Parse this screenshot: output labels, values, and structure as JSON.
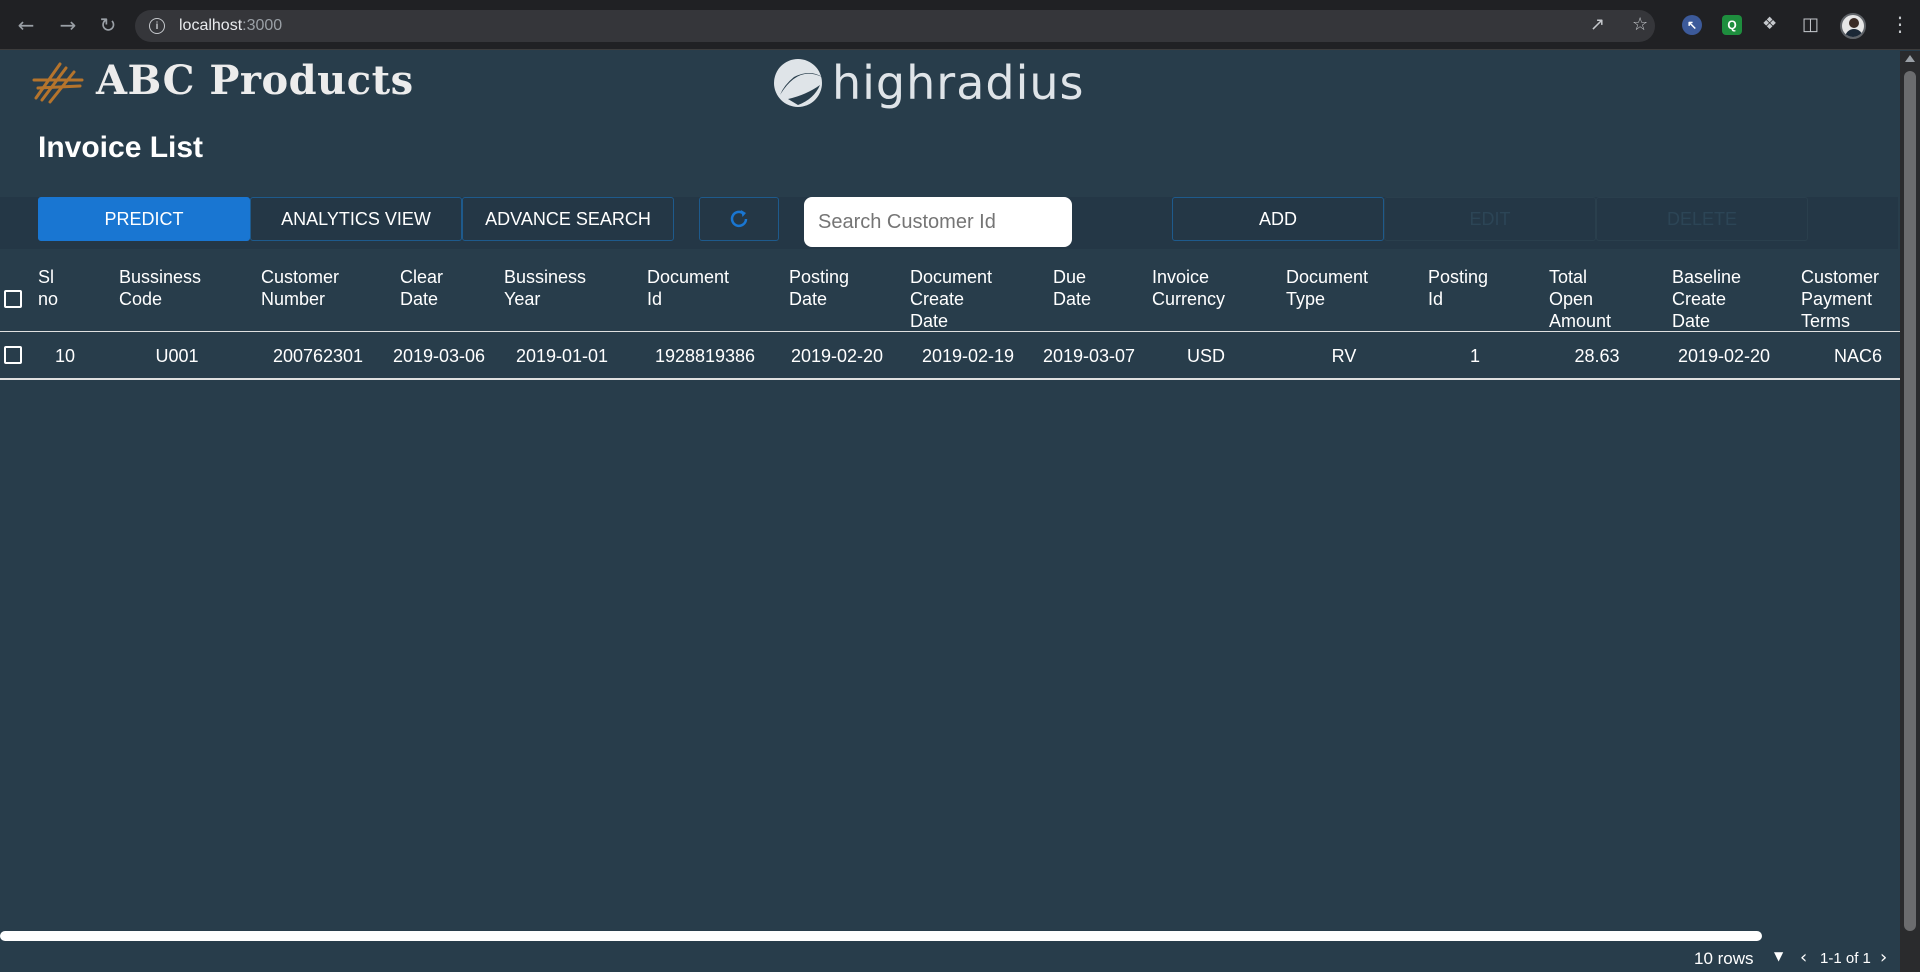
{
  "browser": {
    "url_host": "localhost",
    "url_port": ":3000"
  },
  "header": {
    "brand_name": "ABC Products",
    "partner_name": "highradius"
  },
  "page": {
    "title": "Invoice List"
  },
  "toolbar": {
    "predict": "PREDICT",
    "analytics": "ANALYTICS VIEW",
    "advance_search": "ADVANCE SEARCH",
    "search_placeholder": "Search Customer Id",
    "add": "ADD",
    "edit": "EDIT",
    "delete": "DELETE"
  },
  "colors": {
    "background": "#283d4b",
    "primary": "#1976d2"
  },
  "table": {
    "columns": [
      [
        "Sl",
        "no"
      ],
      [
        "Bussiness",
        "Code"
      ],
      [
        "Customer",
        "Number"
      ],
      [
        "Clear",
        "Date"
      ],
      [
        "Bussiness",
        "Year"
      ],
      [
        "Document",
        "Id"
      ],
      [
        "Posting",
        "Date"
      ],
      [
        "Document",
        "Create",
        "Date"
      ],
      [
        "Due",
        "Date"
      ],
      [
        "Invoice",
        "Currency"
      ],
      [
        "Document",
        "Type"
      ],
      [
        "Posting",
        "Id"
      ],
      [
        "Total",
        "Open",
        "Amount"
      ],
      [
        "Baseline",
        "Create",
        "Date"
      ],
      [
        "Customer",
        "Payment",
        "Terms"
      ]
    ],
    "rows": [
      [
        "10",
        "U001",
        "200762301",
        "2019-03-06",
        "2019-01-01",
        "1928819386",
        "2019-02-20",
        "2019-02-19",
        "2019-03-07",
        "USD",
        "RV",
        "1",
        "28.63",
        "2019-02-20",
        "NAC6"
      ]
    ]
  },
  "footer": {
    "rows_per_page": "10 rows",
    "page_info": "1-1 of 1"
  }
}
